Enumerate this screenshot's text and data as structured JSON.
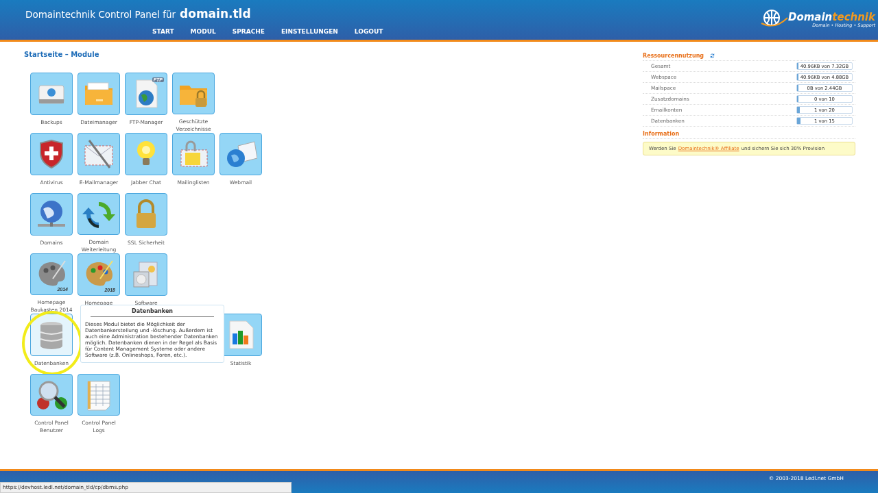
{
  "header": {
    "title": "Domaintechnik Control Panel für",
    "domain": "domain.tld",
    "logo": {
      "word_a": "Domain",
      "word_b": "technik",
      "tagline": "Domain • Hosting • Support"
    }
  },
  "nav": [
    {
      "label": "START"
    },
    {
      "label": "MODUL"
    },
    {
      "label": "SPRACHE"
    },
    {
      "label": "EINSTELLUNGEN"
    },
    {
      "label": "LOGOUT"
    }
  ],
  "page_title": "Startseite – Module",
  "modules": [
    {
      "kind": "module",
      "label": "Backups",
      "highlighted": false,
      "circled": false
    },
    {
      "kind": "module",
      "label": "Dateimanager",
      "highlighted": false,
      "circled": false
    },
    {
      "kind": "module",
      "label": "FTP-Manager",
      "badge": "FTP",
      "highlighted": false,
      "circled": false
    },
    {
      "kind": "module",
      "label": "Geschützte Verzeichnisse",
      "highlighted": false,
      "circled": false
    },
    {
      "kind": "gap"
    },
    {
      "kind": "module",
      "label": "Antivirus",
      "highlighted": false,
      "circled": false
    },
    {
      "kind": "module",
      "label": "E-Mailmanager",
      "highlighted": false,
      "circled": false
    },
    {
      "kind": "module",
      "label": "Jabber Chat",
      "highlighted": false,
      "circled": false
    },
    {
      "kind": "module",
      "label": "Mailinglisten",
      "highlighted": false,
      "circled": false
    },
    {
      "kind": "module",
      "label": "Webmail",
      "highlighted": false,
      "circled": false
    },
    {
      "kind": "module",
      "label": "Domains",
      "highlighted": false,
      "circled": false
    },
    {
      "kind": "module",
      "label": "Domain Weiterleitung",
      "highlighted": false,
      "circled": false
    },
    {
      "kind": "module",
      "label": "SSL Sicherheit",
      "highlighted": false,
      "circled": false
    },
    {
      "kind": "gap"
    },
    {
      "kind": "gap"
    },
    {
      "kind": "module",
      "label": "Homepage Baukasten 2014",
      "badge": "2014",
      "highlighted": false,
      "circled": false
    },
    {
      "kind": "module",
      "label": "Homepage",
      "badge": "2018",
      "highlighted": false,
      "circled": false
    },
    {
      "kind": "module",
      "label": "Software",
      "highlighted": false,
      "circled": false
    },
    {
      "kind": "gap"
    },
    {
      "kind": "gap"
    },
    {
      "kind": "module",
      "label": "Datenbanken",
      "highlighted": true,
      "circled": true
    },
    {
      "kind": "gap"
    },
    {
      "kind": "gap"
    },
    {
      "kind": "gap"
    },
    {
      "kind": "module",
      "label": "Statistik",
      "highlighted": false,
      "circled": false
    },
    {
      "kind": "module",
      "label": "Control Panel Benutzer",
      "highlighted": false,
      "circled": false
    },
    {
      "kind": "module",
      "label": "Control Panel Logs",
      "highlighted": false,
      "circled": false
    }
  ],
  "tooltip": {
    "title": "Datenbanken",
    "text": "Dieses Modul bietet die Möglichkeit der Datenbankerstellung und -löschung. Außerdem ist auch eine Administration bestehender Datenbanken möglich. Datenbanken dienen in der Regel als Basis für Content Management Systeme oder andere Software (z.B. Onlineshops, Foren, etc.)."
  },
  "resources": {
    "title": "Ressourcennutzung",
    "rows": [
      {
        "name": "Gesamt",
        "reading": "40.96KB von 7.32GB",
        "level": 0.002
      },
      {
        "name": "Webspace",
        "reading": "40.96KB von 4.88GB",
        "level": 0.002
      },
      {
        "name": "Mailspace",
        "reading": "0B von 2.44GB",
        "level": 0
      },
      {
        "name": "Zusatzdomains",
        "reading": "0 von 10",
        "level": 0
      },
      {
        "name": "Emailkonten",
        "reading": "1 von 20",
        "level": 0.05
      },
      {
        "name": "Datenbanken",
        "reading": "1 von 15",
        "level": 0.067
      }
    ]
  },
  "information": {
    "title": "Information",
    "before": "Werden Sie",
    "link": "Domaintechnik® Affiliate",
    "after": "und sichern Sie sich 30% Provision"
  },
  "footer": {
    "copyright": "© 2003-2018 Ledl.net GmbH"
  },
  "status_bar": {
    "url": "https://devhost.ledl.net/domain_tld/cp/dbms.php"
  }
}
